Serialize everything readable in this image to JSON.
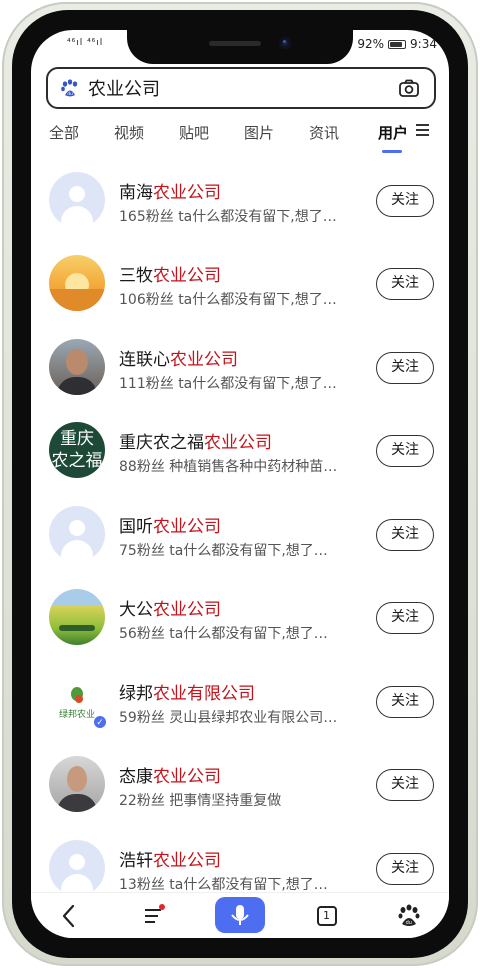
{
  "status_bar": {
    "signal_left": "⁴⁶ıl ⁴⁶ıl",
    "battery_pct": "92%",
    "time": "9:34"
  },
  "search": {
    "query": "农业公司",
    "left_icon": "baidu-paw-icon",
    "right_icon": "camera-icon"
  },
  "tabs": [
    {
      "label": "全部",
      "active": false
    },
    {
      "label": "视频",
      "active": false
    },
    {
      "label": "贴吧",
      "active": false
    },
    {
      "label": "图片",
      "active": false
    },
    {
      "label": "资讯",
      "active": false
    },
    {
      "label": "用户",
      "active": true
    }
  ],
  "results": [
    {
      "name_prefix": "南海",
      "name_highlight": "农业公司",
      "followers": "165粉丝",
      "desc": "ta什么都没有留下,想了…",
      "follow_label": "关注",
      "avatar": "default"
    },
    {
      "name_prefix": "三牧",
      "name_highlight": "农业公司",
      "followers": "106粉丝",
      "desc": "ta什么都没有留下,想了…",
      "follow_label": "关注",
      "avatar": "sunset"
    },
    {
      "name_prefix": "连联心",
      "name_highlight": "农业公司",
      "followers": "111粉丝",
      "desc": "ta什么都没有留下,想了…",
      "follow_label": "关注",
      "avatar": "man-photo"
    },
    {
      "name_prefix": "重庆农之福",
      "name_highlight": "农业公司",
      "followers": "88粉丝",
      "desc": "种植销售各种中药材种苗…",
      "follow_label": "关注",
      "avatar": "text",
      "avatar_text": "重庆\n农之福"
    },
    {
      "name_prefix": "国听",
      "name_highlight": "农业公司",
      "followers": "75粉丝",
      "desc": "ta什么都没有留下,想了…",
      "follow_label": "关注",
      "avatar": "default"
    },
    {
      "name_prefix": "大公",
      "name_highlight": "农业公司",
      "followers": "56粉丝",
      "desc": "ta什么都没有留下,想了…",
      "follow_label": "关注",
      "avatar": "field"
    },
    {
      "name_prefix": "绿邦",
      "name_highlight": "农业有限公司",
      "followers": "59粉丝",
      "desc": "灵山县绿邦农业有限公司…",
      "follow_label": "关注",
      "avatar": "logo",
      "avatar_text": "绿邦农业",
      "verified": true
    },
    {
      "name_prefix": "态康",
      "name_highlight": "农业公司",
      "followers": "22粉丝",
      "desc": "把事情坚持重复做",
      "follow_label": "关注",
      "avatar": "man-photo-2"
    },
    {
      "name_prefix": "浩轩",
      "name_highlight": "农业公司",
      "followers": "13粉丝",
      "desc": "ta什么都没有留下,想了…",
      "follow_label": "关注",
      "avatar": "default"
    }
  ],
  "bottom_nav": {
    "tabs_count": "1"
  },
  "colors": {
    "highlight": "#c4121a",
    "accent": "#4e6ef2"
  }
}
